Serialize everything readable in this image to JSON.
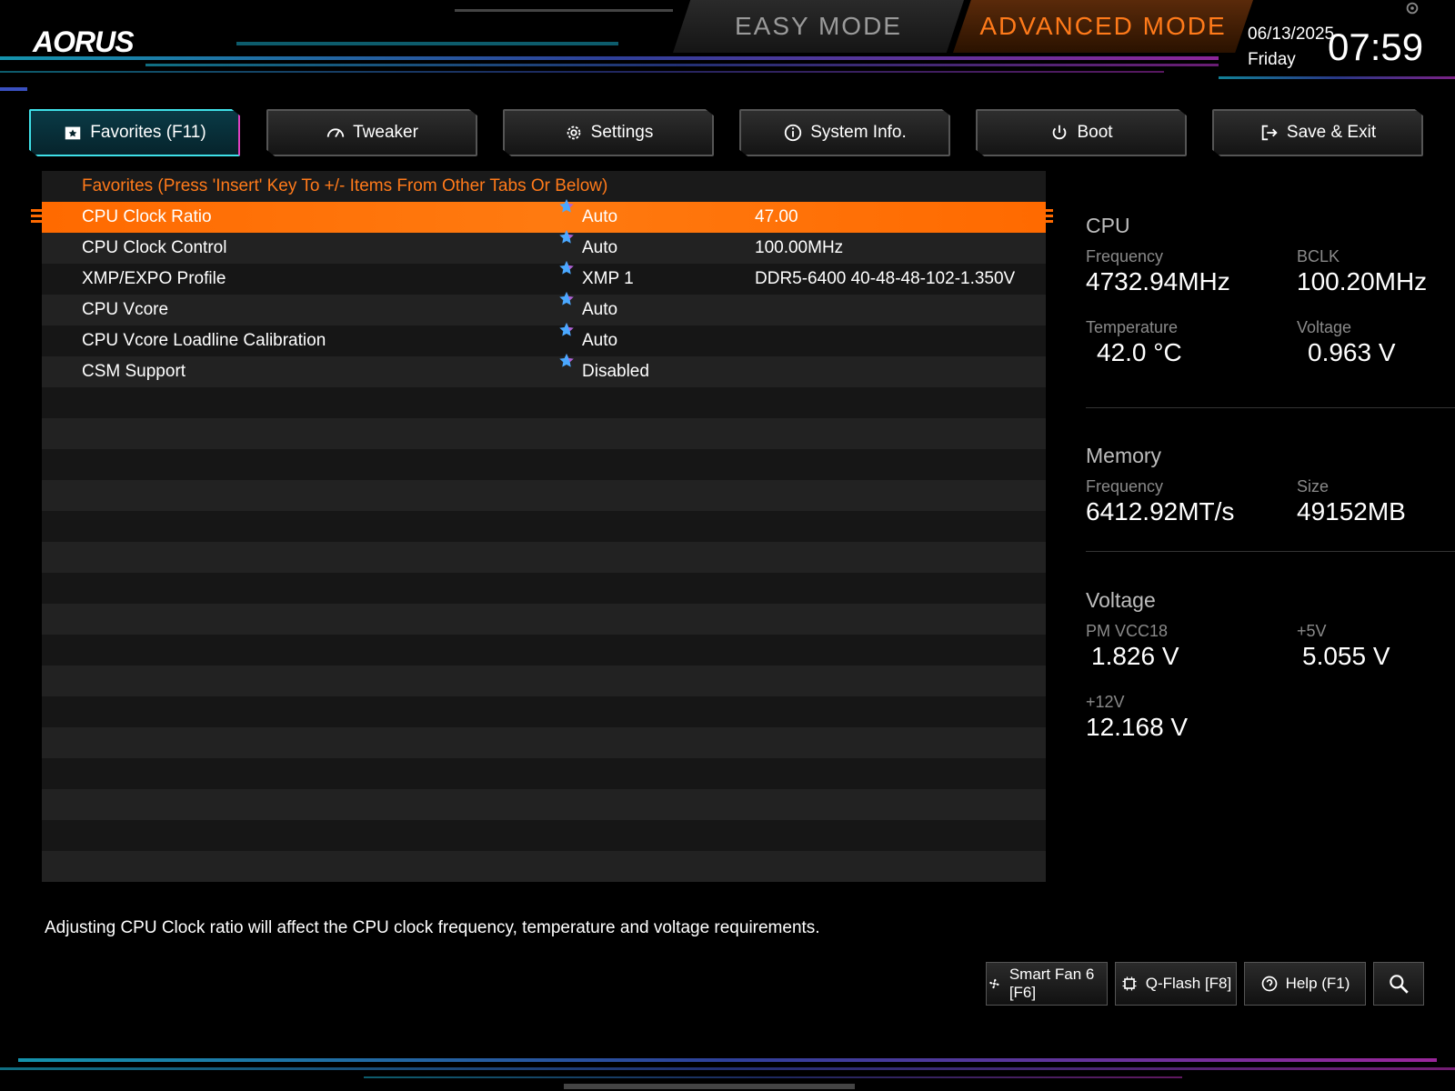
{
  "header": {
    "logo": "AORUS",
    "easy_mode": "EASY MODE",
    "advanced_mode": "ADVANCED MODE",
    "date": "06/13/2025",
    "day": "Friday",
    "time": "07:59"
  },
  "tabs": [
    {
      "label": "Favorites (F11)",
      "icon": "favorites-icon"
    },
    {
      "label": "Tweaker",
      "icon": "speedometer-icon"
    },
    {
      "label": "Settings",
      "icon": "gear-icon"
    },
    {
      "label": "System Info.",
      "icon": "info-icon"
    },
    {
      "label": "Boot",
      "icon": "power-icon"
    },
    {
      "label": "Save & Exit",
      "icon": "exit-icon"
    }
  ],
  "favorites": {
    "header": "Favorites (Press 'Insert' Key To +/- Items From Other Tabs Or Below)",
    "items": [
      {
        "name": "CPU Clock Ratio",
        "value": "Auto",
        "extra": "47.00"
      },
      {
        "name": "CPU Clock Control",
        "value": "Auto",
        "extra": "100.00MHz"
      },
      {
        "name": "XMP/EXPO Profile",
        "value": "XMP 1",
        "extra": "DDR5-6400 40-48-48-102-1.350V"
      },
      {
        "name": "CPU Vcore",
        "value": "Auto",
        "extra": ""
      },
      {
        "name": "CPU Vcore Loadline Calibration",
        "value": "Auto",
        "extra": ""
      },
      {
        "name": "CSM Support",
        "value": "Disabled",
        "extra": ""
      }
    ]
  },
  "description": "Adjusting CPU Clock ratio will affect the CPU clock frequency, temperature and voltage requirements.",
  "panel": {
    "cpu": {
      "title": "CPU",
      "frequency_label": "Frequency",
      "frequency": "4732.94MHz",
      "bclk_label": "BCLK",
      "bclk": "100.20MHz",
      "temperature_label": "Temperature",
      "temperature": "42.0 °C",
      "voltage_label": "Voltage",
      "voltage": "0.963 V"
    },
    "memory": {
      "title": "Memory",
      "frequency_label": "Frequency",
      "frequency": "6412.92MT/s",
      "size_label": "Size",
      "size": "49152MB"
    },
    "voltage": {
      "title": "Voltage",
      "pmvcc18_label": "PM VCC18",
      "pmvcc18": "1.826 V",
      "v5_label": "+5V",
      "v5": "5.055 V",
      "v12_label": "+12V",
      "v12": "12.168 V"
    }
  },
  "bottom_buttons": {
    "smart_fan": "Smart Fan 6 [F6]",
    "qflash": "Q-Flash [F8]",
    "help": "Help (F1)"
  },
  "colors": {
    "accent_orange": "#ff7a1a",
    "accent_cyan": "#3fe0e8",
    "accent_magenta": "#e040c0"
  }
}
